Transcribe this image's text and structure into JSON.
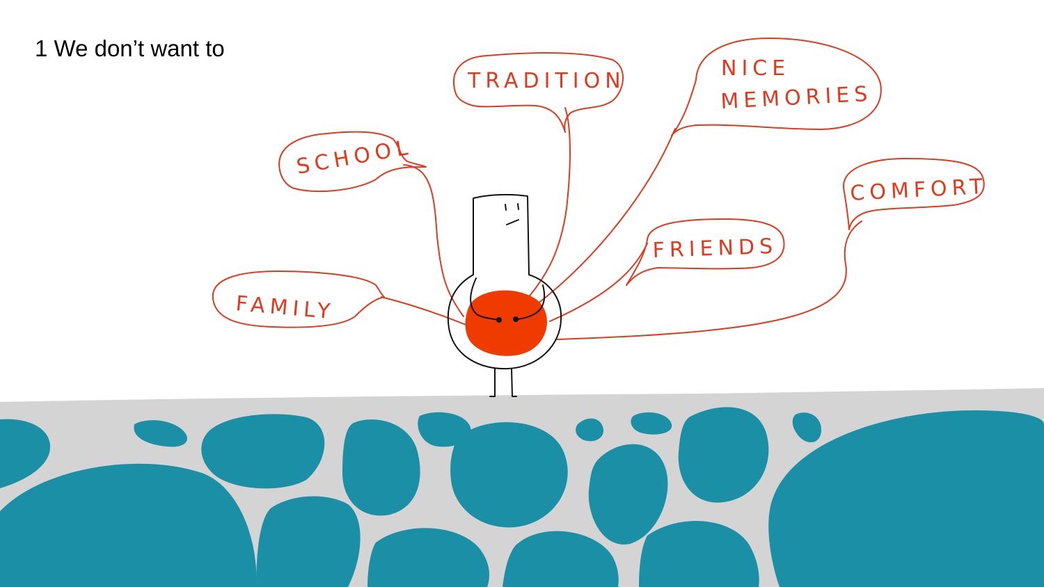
{
  "slide": {
    "title": "1 We don’t want to"
  },
  "bubbles": [
    {
      "id": "tradition",
      "label": "TRADITION"
    },
    {
      "id": "school",
      "label": "SCHOOL"
    },
    {
      "id": "nice-memories",
      "line1": "NICE",
      "line2": "MEMORIES"
    },
    {
      "id": "comfort",
      "label": "COMFORT"
    },
    {
      "id": "friends",
      "label": "FRIENDS"
    },
    {
      "id": "family",
      "label": "FAMILY"
    }
  ],
  "colors": {
    "accent_line": "#e2381c",
    "heart_fill": "#ef3a00",
    "ground": "#d4d4d4",
    "water": "#1a8fa6",
    "ink": "#111111"
  }
}
